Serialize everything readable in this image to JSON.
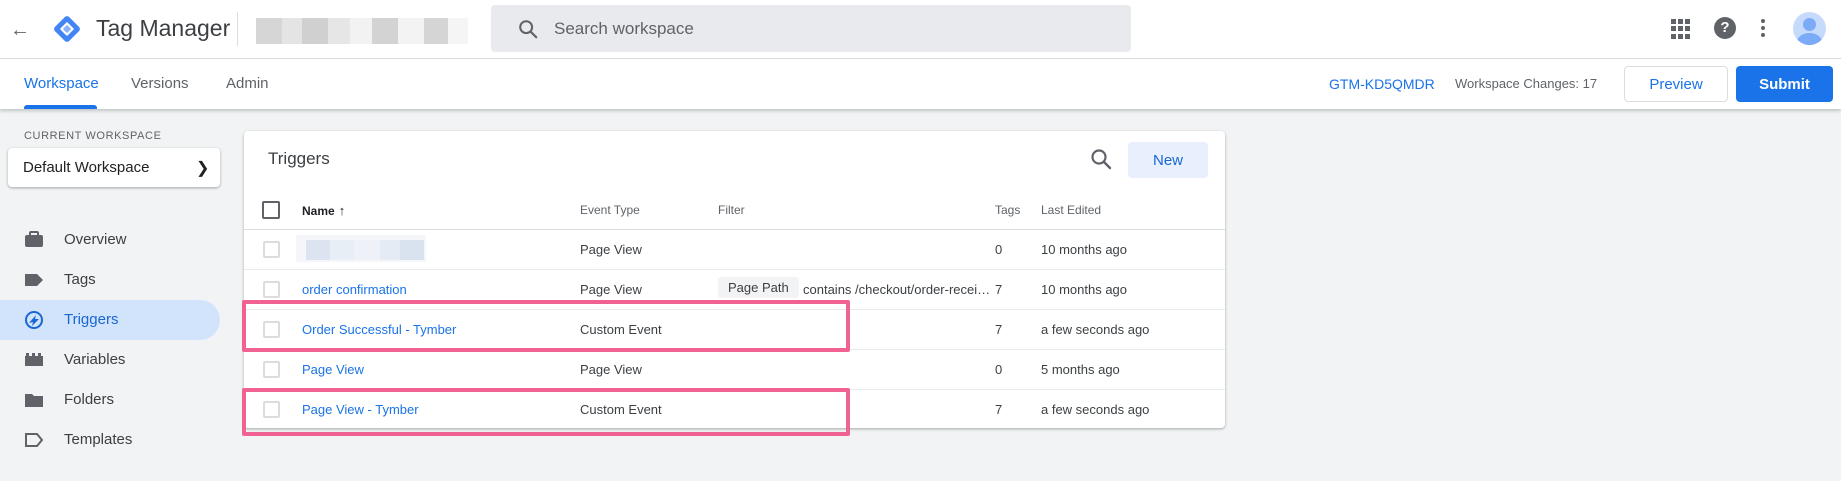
{
  "topbar": {
    "back_icon": "arrow-back-icon",
    "app_title": "Tag Manager",
    "search_placeholder": "Search workspace",
    "icons": [
      "apps-icon",
      "help-icon",
      "more-vert-icon",
      "avatar"
    ]
  },
  "subnav": {
    "tabs": [
      {
        "label": "Workspace",
        "active": true
      },
      {
        "label": "Versions",
        "active": false
      },
      {
        "label": "Admin",
        "active": false
      }
    ],
    "container_id": "GTM-KD5QMDR",
    "workspace_changes": "Workspace Changes: 17",
    "preview_label": "Preview",
    "submit_label": "Submit"
  },
  "sidebar": {
    "current_workspace_label": "CURRENT WORKSPACE",
    "workspace_name": "Default Workspace",
    "items": [
      {
        "label": "Overview",
        "icon": "briefcase-icon",
        "active": false
      },
      {
        "label": "Tags",
        "icon": "tag-icon",
        "active": false
      },
      {
        "label": "Triggers",
        "icon": "trigger-icon",
        "active": true
      },
      {
        "label": "Variables",
        "icon": "variables-icon",
        "active": false
      },
      {
        "label": "Folders",
        "icon": "folder-icon",
        "active": false
      },
      {
        "label": "Templates",
        "icon": "template-icon",
        "active": false
      }
    ]
  },
  "triggers": {
    "title": "Triggers",
    "new_label": "New",
    "columns": [
      "Name",
      "Event Type",
      "Filter",
      "Tags",
      "Last Edited"
    ],
    "rows": [
      {
        "name": "",
        "event_type": "Page View",
        "filter_var": "",
        "filter_text": "",
        "tags": "0",
        "last_edited": "10 months ago",
        "highlighted": false
      },
      {
        "name": "order confirmation",
        "event_type": "Page View",
        "filter_var": "Page Path",
        "filter_text": "contains /checkout/order-received",
        "tags": "7",
        "last_edited": "10 months ago",
        "highlighted": false
      },
      {
        "name": "Order Successful - Tymber",
        "event_type": "Custom Event",
        "filter_var": "",
        "filter_text": "",
        "tags": "7",
        "last_edited": "a few seconds ago",
        "highlighted": true
      },
      {
        "name": "Page View",
        "event_type": "Page View",
        "filter_var": "",
        "filter_text": "",
        "tags": "0",
        "last_edited": "5 months ago",
        "highlighted": false
      },
      {
        "name": "Page View - Tymber",
        "event_type": "Custom Event",
        "filter_var": "",
        "filter_text": "",
        "tags": "7",
        "last_edited": "a few seconds ago",
        "highlighted": true
      }
    ]
  },
  "colors": {
    "accent": "#1a73e8",
    "highlight": "#f06292",
    "active_nav_bg": "#d2e3fc"
  }
}
